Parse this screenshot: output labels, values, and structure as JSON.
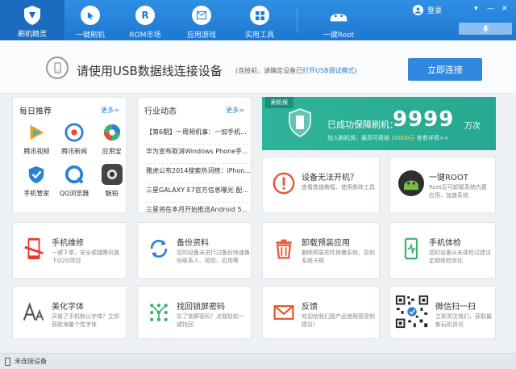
{
  "topbar": {
    "app_name": "刷机精灵",
    "nav": [
      {
        "label": "一键刷机"
      },
      {
        "label": "ROM市场"
      },
      {
        "label": "应用游戏"
      },
      {
        "label": "实用工具"
      },
      {
        "label": "一键Root"
      }
    ],
    "login_label": "登录",
    "window_controls": [
      "▾",
      "—",
      "✕"
    ]
  },
  "banner": {
    "title": "请使用USB数据线连接设备",
    "hint_prefix": "(连接前，请确定设备已",
    "hint_link": "打开USB调试模式",
    "hint_suffix": ")",
    "connect_label": "立即连接"
  },
  "daily": {
    "title": "每日推荐",
    "more": "更多>",
    "items": [
      {
        "label": "腾讯视频",
        "icon": "tencent-video-icon",
        "color": "#f0a020"
      },
      {
        "label": "腾讯新闻",
        "icon": "tencent-news-icon",
        "color": "#2a7fd6"
      },
      {
        "label": "应用宝",
        "icon": "app-store-icon",
        "color": "#3cb371"
      },
      {
        "label": "手机管家",
        "icon": "phone-manager-icon",
        "color": "#2a7fd6"
      },
      {
        "label": "QQ浏览器",
        "icon": "qq-browser-icon",
        "color": "#2a7fd6"
      },
      {
        "label": "魅拍",
        "icon": "camera-icon",
        "color": "#555555"
      }
    ]
  },
  "industry": {
    "title": "行业动态",
    "more": "更多>",
    "news": [
      "【第6期】一周频机事：一加手机...",
      "华为宣布取消Windows Phone手...",
      "雅虎公布2014搜索热词榜：iPhon...",
      "三星GALAXY E7官方信息曝光 配5...",
      "三星将在本月开始推送Android 5..."
    ]
  },
  "insurance": {
    "tag": "刷机保",
    "main_text": "已成功保障刷机：",
    "count": "9999",
    "unit": "万次",
    "sub_prefix": "加入刷机保，最高可获赔",
    "amount": "10000元",
    "review": "查看详情>>"
  },
  "cards": [
    {
      "title": "设备无法开机？",
      "desc": "查看救援教程，使用救砖工具",
      "icon": "warning-icon",
      "color": "#e8542f"
    },
    {
      "title": "一键ROOT",
      "desc": "Root后可卸载系统内置应用，加速系统",
      "icon": "android-root-icon",
      "color": "#3a8c3a"
    },
    {
      "title": "手机维修",
      "desc": "一键下单，安全便捷腾讯旗下O2O项目",
      "icon": "repair-phone-icon",
      "color": "#e83a2f"
    },
    {
      "title": "备份资料",
      "desc": "您的设备未进行过备份快速备份联系人、短信、应用等",
      "icon": "backup-icon",
      "color": "#2a7fd6"
    },
    {
      "title": "卸载预装应用",
      "desc": "删除预装软件拖慢系统，告别系统卡顿",
      "icon": "trash-icon",
      "color": "#e8542f"
    },
    {
      "title": "手机体检",
      "desc": "您的设备从未体检过建议定期体检优化",
      "icon": "checkup-icon",
      "color": "#3cb371"
    },
    {
      "title": "美化字体",
      "desc": "厌倦了手机默认字体？立即获取海量个性字体",
      "icon": "font-icon",
      "color": "#555555"
    },
    {
      "title": "找回锁屏密码",
      "desc": "忘了锁屏密码？点我轻松一键找回",
      "icon": "pattern-lock-icon",
      "color": "#3cb371"
    },
    {
      "title": "反馈",
      "desc": "欢迎给我们提产品使用感受和建议！",
      "icon": "mail-icon",
      "color": "#e8542f"
    },
    {
      "title": "微信扫一扫",
      "desc": "立即关注我们，获取最新玩机资讯",
      "icon": "qr-code-icon",
      "color": "#333333"
    }
  ],
  "status": {
    "text": "未连接设备"
  }
}
